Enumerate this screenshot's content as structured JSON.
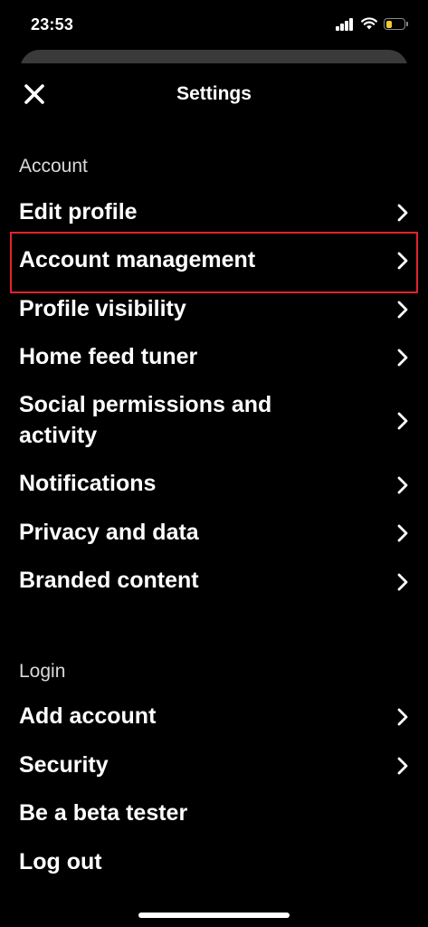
{
  "status_bar": {
    "time": "23:53",
    "battery_level": 0.35,
    "battery_color": "#f2cc2f"
  },
  "header": {
    "title": "Settings",
    "close_icon": "close-icon"
  },
  "sections": {
    "account": {
      "heading": "Account",
      "items": [
        {
          "label": "Edit profile",
          "icon": "chevron-right-icon"
        },
        {
          "label": "Account management",
          "icon": "chevron-right-icon",
          "highlighted": true,
          "highlight_color": "#e0242c"
        },
        {
          "label": "Profile visibility",
          "icon": "chevron-right-icon"
        },
        {
          "label": "Home feed tuner",
          "icon": "chevron-right-icon"
        },
        {
          "label": "Social permissions and activity",
          "icon": "chevron-right-icon"
        },
        {
          "label": "Notifications",
          "icon": "chevron-right-icon"
        },
        {
          "label": "Privacy and data",
          "icon": "chevron-right-icon"
        },
        {
          "label": "Branded content",
          "icon": "chevron-right-icon"
        }
      ]
    },
    "login": {
      "heading": "Login",
      "items": [
        {
          "label": "Add account",
          "icon": "chevron-right-icon"
        },
        {
          "label": "Security",
          "icon": "chevron-right-icon"
        },
        {
          "label": "Be a beta tester"
        },
        {
          "label": "Log out"
        }
      ]
    }
  }
}
